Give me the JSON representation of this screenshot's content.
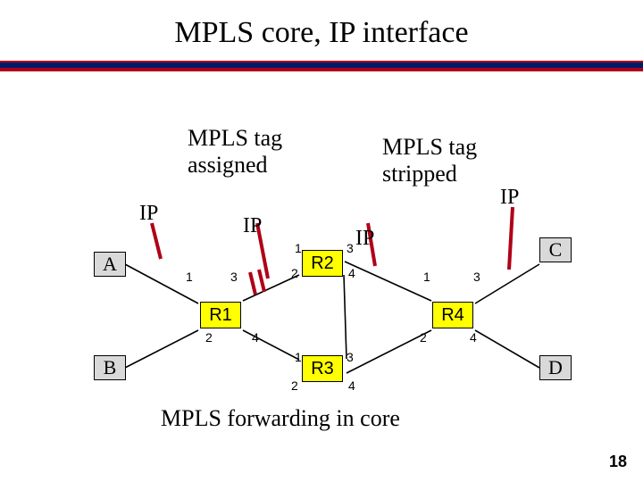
{
  "title": "MPLS core, IP interface",
  "captions": {
    "assigned_l1": "MPLS tag",
    "assigned_l2": "assigned",
    "stripped_l1": "MPLS tag",
    "stripped_l2": "stripped",
    "core": "MPLS forwarding in core"
  },
  "ip_labels": {
    "a": "IP",
    "b": "IP",
    "c": "IP",
    "d": "IP"
  },
  "hosts": {
    "A": "A",
    "B": "B",
    "C": "C",
    "D": "D"
  },
  "routers": {
    "R1": "R1",
    "R2": "R2",
    "R3": "R3",
    "R4": "R4"
  },
  "ports": {
    "r1_1": "1",
    "r1_2": "2",
    "r1_3": "3",
    "r1_4": "4",
    "r2_1": "1",
    "r2_2": "2",
    "r2_3": "3",
    "r2_4": "4",
    "r3_1": "1",
    "r3_2": "2",
    "r3_3": "3",
    "r3_4": "4",
    "r4_1": "1",
    "r4_2": "2",
    "r4_3": "3",
    "r4_4": "4"
  },
  "pagenum": "18",
  "chart_data": {
    "type": "diagram",
    "title": "MPLS core, IP interface",
    "annotations": [
      "MPLS tag assigned",
      "MPLS tag stripped",
      "MPLS forwarding in core"
    ],
    "nodes": [
      {
        "id": "A",
        "kind": "host",
        "label": "A"
      },
      {
        "id": "B",
        "kind": "host",
        "label": "B"
      },
      {
        "id": "C",
        "kind": "host",
        "label": "C"
      },
      {
        "id": "D",
        "kind": "host",
        "label": "D"
      },
      {
        "id": "R1",
        "kind": "router",
        "label": "R1",
        "ports": [
          1,
          2,
          3,
          4
        ]
      },
      {
        "id": "R2",
        "kind": "router",
        "label": "R2",
        "ports": [
          1,
          2,
          3,
          4
        ]
      },
      {
        "id": "R3",
        "kind": "router",
        "label": "R3",
        "ports": [
          1,
          2,
          3,
          4
        ]
      },
      {
        "id": "R4",
        "kind": "router",
        "label": "R4",
        "ports": [
          1,
          2,
          3,
          4
        ]
      }
    ],
    "edges": [
      {
        "from": "A",
        "to": "R1",
        "via_port": 1,
        "proto": "IP"
      },
      {
        "from": "B",
        "to": "R1",
        "via_port": 2,
        "proto": "IP"
      },
      {
        "from": "R1",
        "to": "R2",
        "from_port": 3,
        "to_port": 2
      },
      {
        "from": "R1",
        "to": "R3",
        "from_port": 4,
        "to_port": 1
      },
      {
        "from": "R2",
        "to": "R4",
        "from_port": 3,
        "to_port": 1,
        "highlighted": true
      },
      {
        "from": "R2",
        "to": "R3",
        "from_port": 4,
        "to_port": 3
      },
      {
        "from": "R3",
        "to": "R4",
        "from_port": 3,
        "to_port": 2
      },
      {
        "from": "R4",
        "to": "C",
        "via_port": 3,
        "proto": "IP"
      },
      {
        "from": "R4",
        "to": "D",
        "via_port": 4,
        "proto": "IP"
      }
    ],
    "highlighted_path": [
      "A",
      "R1",
      "R2",
      "R4",
      "C"
    ],
    "ip_pointers": [
      {
        "near": "A-R1",
        "label": "IP"
      },
      {
        "near": "R1-R2",
        "label": "IP"
      },
      {
        "near": "R2-R4",
        "label": "IP"
      },
      {
        "near": "R4-C",
        "label": "IP"
      }
    ]
  }
}
